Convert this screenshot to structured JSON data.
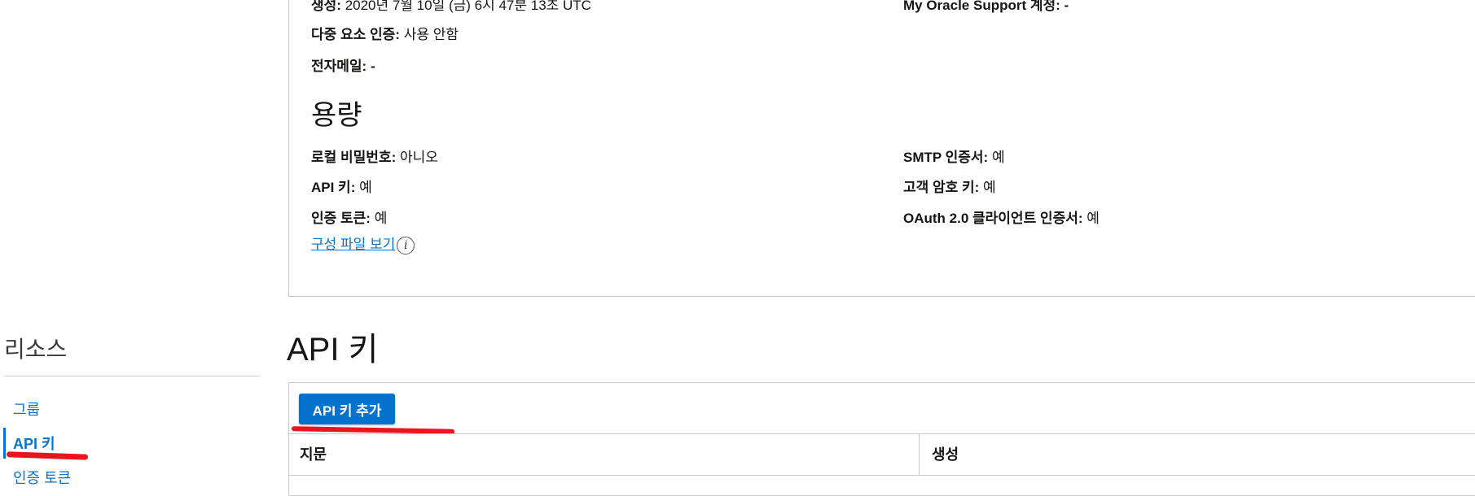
{
  "user_info": {
    "created_label": "생성:",
    "created_value": "2020년 7월 10일 (금) 6시 47분 13초 UTC",
    "mfa_label": "다중 요소 인증:",
    "mfa_value": "사용 안함",
    "email_label": "전자메일:",
    "email_value": "-",
    "support_label": "My Oracle Support 계정:",
    "support_value": "-"
  },
  "capabilities": {
    "title": "용량",
    "local_password_label": "로컬 비밀번호:",
    "local_password_value": "아니오",
    "api_keys_label": "API 키:",
    "api_keys_value": "예",
    "auth_tokens_label": "인증 토큰:",
    "auth_tokens_value": "예",
    "smtp_label": "SMTP 인증서:",
    "smtp_value": "예",
    "customer_secret_label": "고객 암호 키:",
    "customer_secret_value": "예",
    "oauth_label": "OAuth 2.0 클라이언트 인증서:",
    "oauth_value": "예",
    "view_config_link": "구성 파일 보기",
    "info_icon_glyph": "i"
  },
  "sidebar": {
    "title": "리소스",
    "items": [
      {
        "label": "그룹"
      },
      {
        "label": "API 키"
      },
      {
        "label": "인증 토큰"
      }
    ]
  },
  "main": {
    "title": "API 키",
    "add_button": "API 키 추가",
    "columns": [
      "지문",
      "생성"
    ]
  },
  "colors": {
    "link": "#0572ce",
    "primary_button": "#0572ce",
    "annotation": "#e8141e"
  }
}
